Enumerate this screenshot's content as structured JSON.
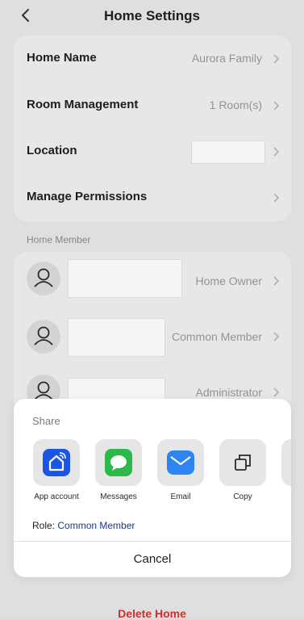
{
  "header": {
    "title": "Home Settings",
    "back_icon": "chevron-left-icon"
  },
  "settings": [
    {
      "label": "Home Name",
      "value": "Aurora Family"
    },
    {
      "label": "Room Management",
      "value": "1 Room(s)"
    },
    {
      "label": "Location",
      "value": ""
    },
    {
      "label": "Manage Permissions",
      "value": ""
    }
  ],
  "members_section": {
    "label": "Home Member",
    "members": [
      {
        "role": "Home Owner"
      },
      {
        "role": "Common Member"
      },
      {
        "role": "Administrator"
      }
    ]
  },
  "share_sheet": {
    "title": "Share",
    "targets": [
      {
        "label": "App account",
        "icon": "home-wifi-icon",
        "color": "#1a55e3"
      },
      {
        "label": "Messages",
        "icon": "message-bubble-icon",
        "color": "#2db84a"
      },
      {
        "label": "Email",
        "icon": "envelope-icon",
        "color": "#2e84f0"
      },
      {
        "label": "Copy",
        "icon": "copy-icon",
        "color": "#e6e6e6"
      }
    ],
    "role_prefix": "Role:",
    "role_value": "Common Member",
    "cancel": "Cancel"
  },
  "footer": {
    "delete_label": "Delete Home"
  },
  "colors": {
    "accent_link": "#1b3a8e",
    "danger": "#d8312f"
  }
}
